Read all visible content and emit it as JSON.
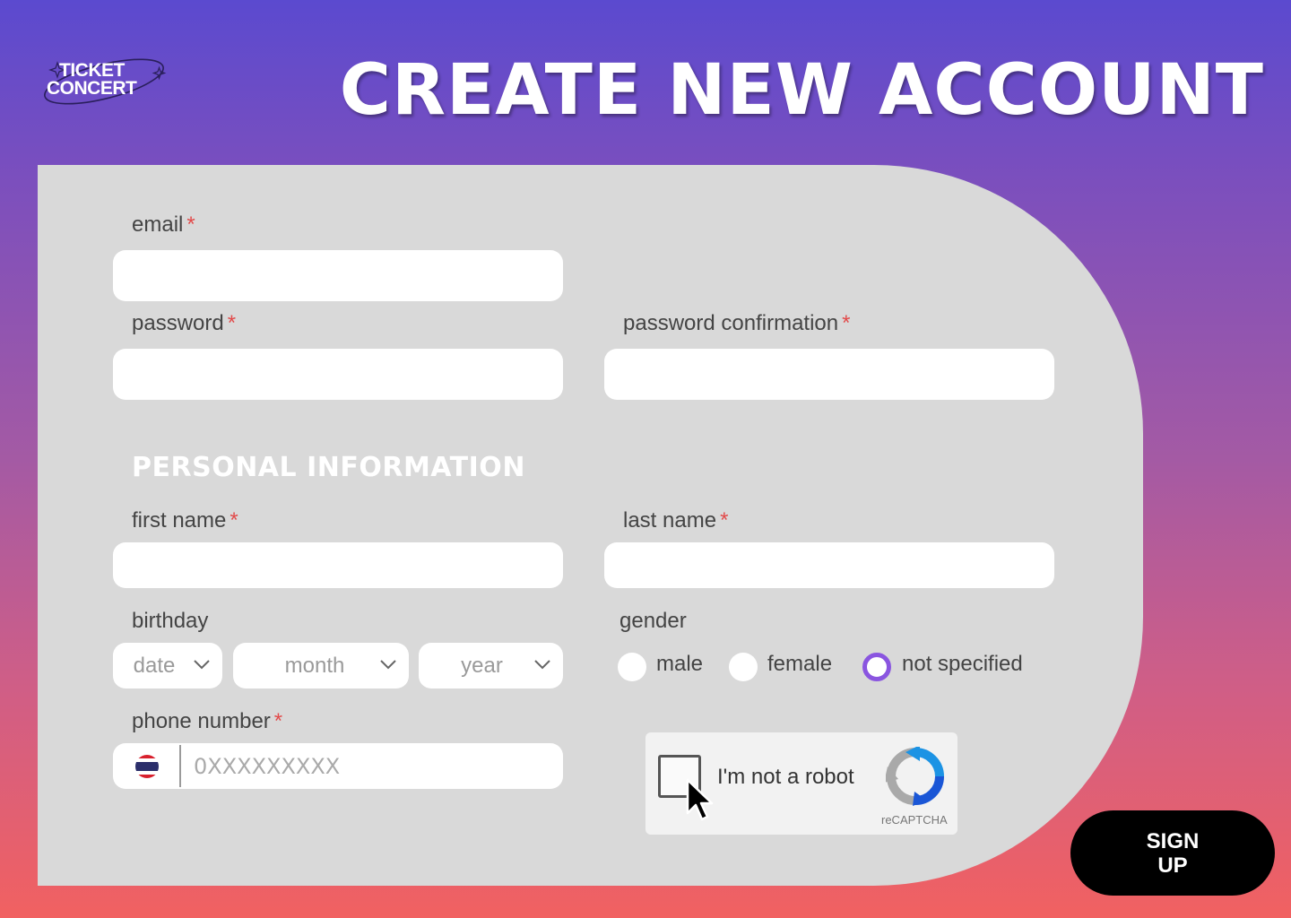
{
  "brand": {
    "line1": "TICKET",
    "line2": "CONCERT"
  },
  "page": {
    "title": "CREATE NEW ACCOUNT"
  },
  "form": {
    "required_mark": "*",
    "email": {
      "label": "email",
      "value": ""
    },
    "password": {
      "label": "password",
      "value": ""
    },
    "password_confirmation": {
      "label": "password confirmation",
      "value": ""
    },
    "personal_section_title": "PERSONAL INFORMATION",
    "first_name": {
      "label": "first name",
      "value": ""
    },
    "last_name": {
      "label": "last name",
      "value": ""
    },
    "birthday": {
      "label": "birthday",
      "date": "date",
      "month": "month",
      "year": "year"
    },
    "gender": {
      "label": "gender",
      "options": [
        "male",
        "female",
        "not specified"
      ],
      "selected": "not specified"
    },
    "phone": {
      "label": "phone number",
      "placeholder": "0XXXXXXXXX",
      "country_icon": "thailand-flag-icon"
    },
    "captcha": {
      "text": "I'm not a robot",
      "brand": "reCAPTCHA"
    },
    "submit_label": "SIGN UP"
  },
  "colors": {
    "gradient_top": "#5b4acf",
    "gradient_bottom": "#f16161",
    "card": "#d9d9d9",
    "required": "#e24a4a",
    "radio_selected": "#8a55e0",
    "button": "#000000"
  }
}
